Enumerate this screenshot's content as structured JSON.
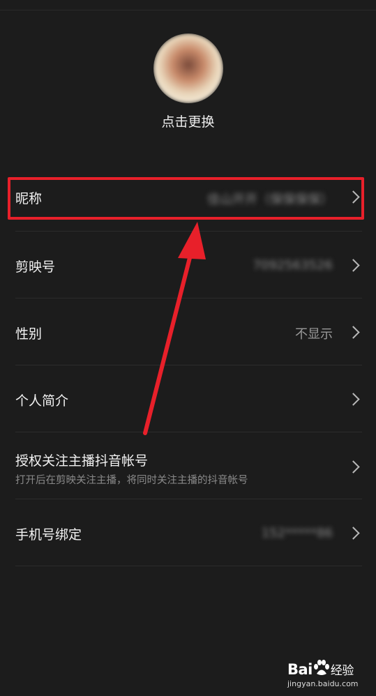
{
  "profile": {
    "avatar_caption": "点击更换"
  },
  "rows": [
    {
      "label": "昵称",
      "value": "佳山开开（保保保保）",
      "value_blurred": true
    },
    {
      "label": "剪映号",
      "value": "7092563526",
      "value_blurred": true
    },
    {
      "label": "性别",
      "value": "不显示",
      "value_blurred": false
    },
    {
      "label": "个人简介",
      "value": "",
      "value_blurred": false
    },
    {
      "label": "授权关注主播抖音帐号",
      "sub": "打开后在剪映关注主播，将同时关注主播的抖音帐号"
    },
    {
      "label": "手机号绑定",
      "value": "152*****86",
      "value_blurred": true
    }
  ],
  "annotation": {
    "highlight_color": "#e8202a",
    "arrow_color": "#e8202a"
  },
  "watermark": {
    "brand_left": "Bai",
    "brand_right": "经验",
    "url": "jingyan.baidu.com"
  }
}
